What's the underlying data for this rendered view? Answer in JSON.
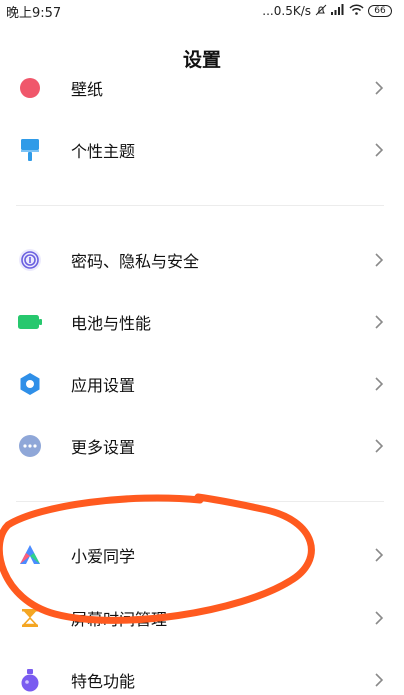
{
  "status_bar": {
    "time": "晚上9:57",
    "network_speed": "...0.5K/s",
    "battery_level": "66"
  },
  "header": {
    "title": "设置"
  },
  "items": [
    {
      "label": "壁纸",
      "icon": "wallpaper-icon",
      "color": "#f0576b"
    },
    {
      "label": "个性主题",
      "icon": "theme-brush-icon",
      "color": "#2f9be8"
    },
    {
      "label": "密码、隐私与安全",
      "icon": "fingerprint-icon",
      "color": "#6a5fe0"
    },
    {
      "label": "电池与性能",
      "icon": "battery-icon",
      "color": "#27c86e"
    },
    {
      "label": "应用设置",
      "icon": "gear-icon",
      "color": "#2f8fe8"
    },
    {
      "label": "更多设置",
      "icon": "more-dots-icon",
      "color": "#8fa7d8"
    },
    {
      "label": "小爱同学",
      "icon": "xiaoai-icon",
      "color": "#4a8cff"
    },
    {
      "label": "屏幕时间管理",
      "icon": "hourglass-icon",
      "color": "#f4a623"
    },
    {
      "label": "特色功能",
      "icon": "flask-icon",
      "color": "#7a5cf0"
    }
  ],
  "annotation_color": "#ff5a1f"
}
